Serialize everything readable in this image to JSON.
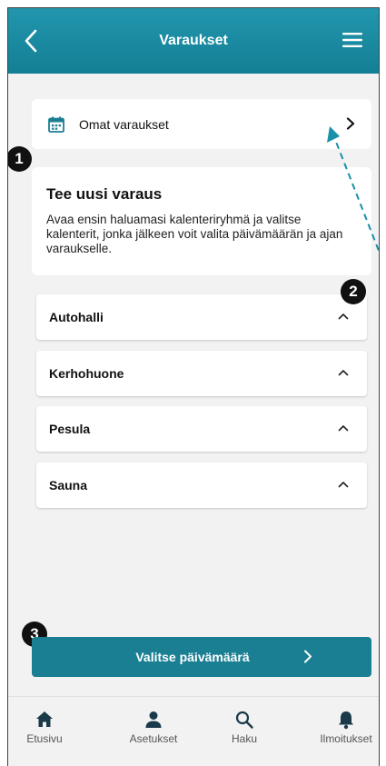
{
  "header": {
    "title": "Varaukset"
  },
  "own_reservations": {
    "label": "Omat varaukset"
  },
  "new_reservation": {
    "title": "Tee uusi varaus",
    "description": "Avaa ensin haluamasi kalenteriryhmä ja valitse kalenterit, jonka jälkeen voit valita päivämäärän ja ajan varaukselle."
  },
  "calendar_groups": [
    {
      "label": "Autohalli"
    },
    {
      "label": "Kerhohuone"
    },
    {
      "label": "Pesula"
    },
    {
      "label": "Sauna"
    }
  ],
  "primary_button": {
    "label": "Valitse päivämäärä"
  },
  "badges": [
    "1",
    "2",
    "3"
  ],
  "tabbar": {
    "items": [
      {
        "label": "Etusivu",
        "icon": "home-icon"
      },
      {
        "label": "Asetukset",
        "icon": "person-icon"
      },
      {
        "label": "Haku",
        "icon": "search-icon"
      },
      {
        "label": "Ilmoitukset",
        "icon": "bell-icon"
      }
    ]
  },
  "colors": {
    "brand": "#1b7f93",
    "header": "#2196ad",
    "annotation_arrow": "#1a8fa8"
  }
}
